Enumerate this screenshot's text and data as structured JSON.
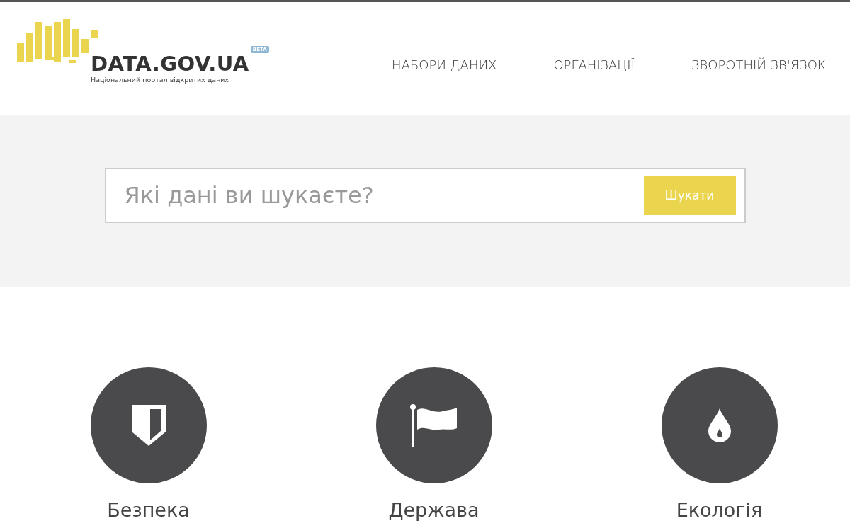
{
  "logo": {
    "title": "DATA.GOV.UA",
    "badge": "BETA",
    "subtitle": "Національний портал відкритих даних"
  },
  "nav": [
    "НАБОРИ ДАНИХ",
    "ОРГАНІЗАЦІЇ",
    "ЗВОРОТНІЙ ЗВ'ЯЗОК"
  ],
  "search": {
    "placeholder": "Які дані ви шукаєте?",
    "button": "Шукати"
  },
  "categories": [
    {
      "kind": "shield",
      "label": "Безпека"
    },
    {
      "kind": "flag",
      "label": "Держава"
    },
    {
      "kind": "drop",
      "label": "Екологія"
    }
  ]
}
